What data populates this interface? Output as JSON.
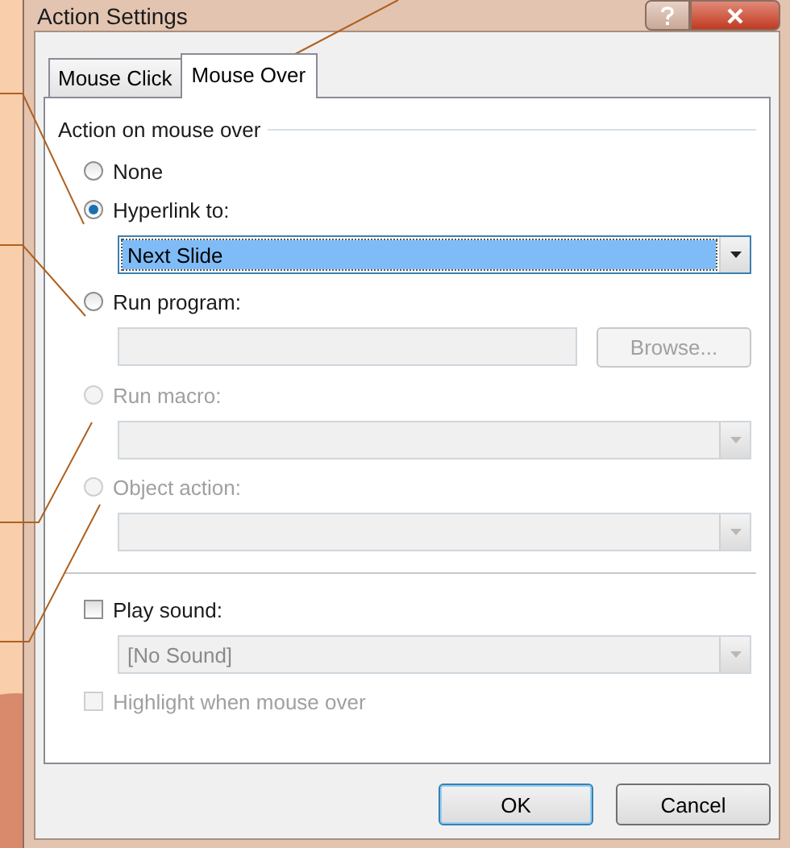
{
  "window": {
    "title": "Action Settings"
  },
  "tabs": [
    {
      "label": "Mouse Click",
      "selected": false
    },
    {
      "label": "Mouse Over",
      "selected": true
    }
  ],
  "group": {
    "title": "Action on mouse over"
  },
  "options": [
    {
      "label": "None",
      "selected": false,
      "disabled": false
    },
    {
      "label": "Hyperlink to:",
      "selected": true,
      "disabled": false,
      "control": {
        "kind": "dropdown",
        "value": "Next Slide",
        "highlighted": true,
        "disabled": false
      }
    },
    {
      "label": "Run program:",
      "selected": false,
      "disabled": false,
      "control": {
        "kind": "field",
        "disabled": true,
        "button": {
          "label": "Browse...",
          "disabled": true
        }
      }
    },
    {
      "label": "Run macro:",
      "selected": false,
      "disabled": true,
      "control": {
        "kind": "dropdown",
        "disabled": true
      }
    },
    {
      "label": "Object action:",
      "selected": false,
      "disabled": true,
      "control": {
        "kind": "dropdown",
        "disabled": true
      }
    }
  ],
  "sound": {
    "label": "Play sound:",
    "checked": false,
    "disabled": false,
    "dropdown": {
      "value": "[No Sound]",
      "disabled": true
    }
  },
  "highlight": {
    "label": "Highlight when mouse over",
    "checked": false,
    "disabled": true
  },
  "buttons": [
    {
      "label": "OK",
      "default": true
    },
    {
      "label": "Cancel",
      "default": false
    }
  ]
}
